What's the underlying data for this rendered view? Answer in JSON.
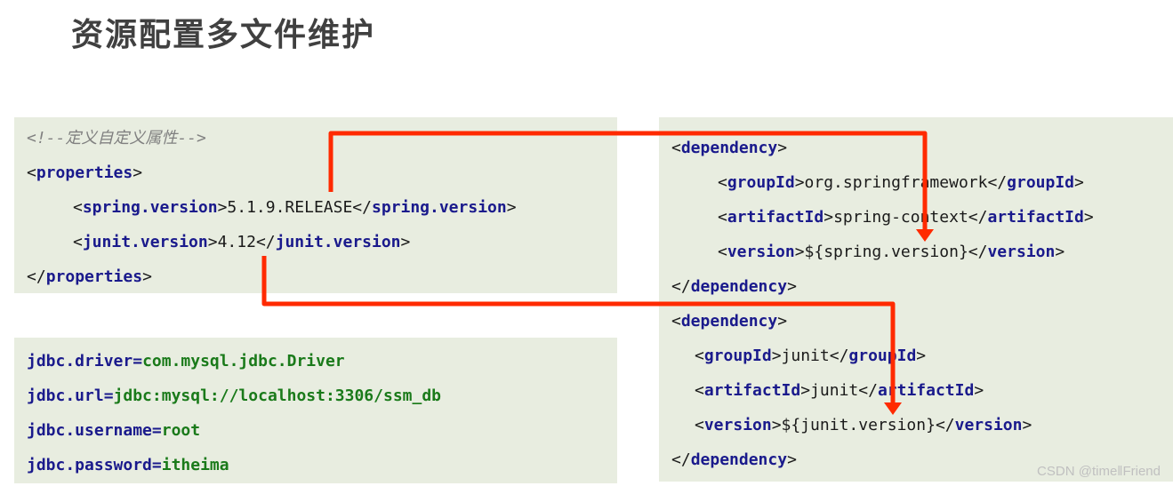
{
  "title": "资源配置多文件维护",
  "left_top": {
    "comment": "<!--定义自定义属性-->",
    "lines": [
      {
        "open": "properties"
      },
      {
        "open": "spring.version",
        "value": "5.1.9.RELEASE",
        "close": "spring.version"
      },
      {
        "open": "junit.version",
        "value": "4.12",
        "close": "junit.version"
      },
      {
        "close_only": "properties"
      }
    ]
  },
  "left_bottom": {
    "props": [
      {
        "key": "jdbc.driver",
        "value": "com.mysql.jdbc.Driver"
      },
      {
        "key": "jdbc.url",
        "value": "jdbc:mysql://localhost:3306/ssm_db"
      },
      {
        "key": "jdbc.username",
        "value": "root"
      },
      {
        "key": "jdbc.password",
        "value": "itheima"
      }
    ]
  },
  "right": {
    "dep1": {
      "tag": "dependency",
      "groupId": "org.springframework",
      "artifactId": "spring-context",
      "version": "${spring.version}"
    },
    "dep2": {
      "tag": "dependency",
      "groupId": "junit",
      "artifactId": "junit",
      "version": "${junit.version}"
    },
    "tags": {
      "groupId": "groupId",
      "artifactId": "artifactId",
      "version": "version"
    }
  },
  "arrow_color": "#ff2a00",
  "watermark": "CSDN @time‖Friend"
}
